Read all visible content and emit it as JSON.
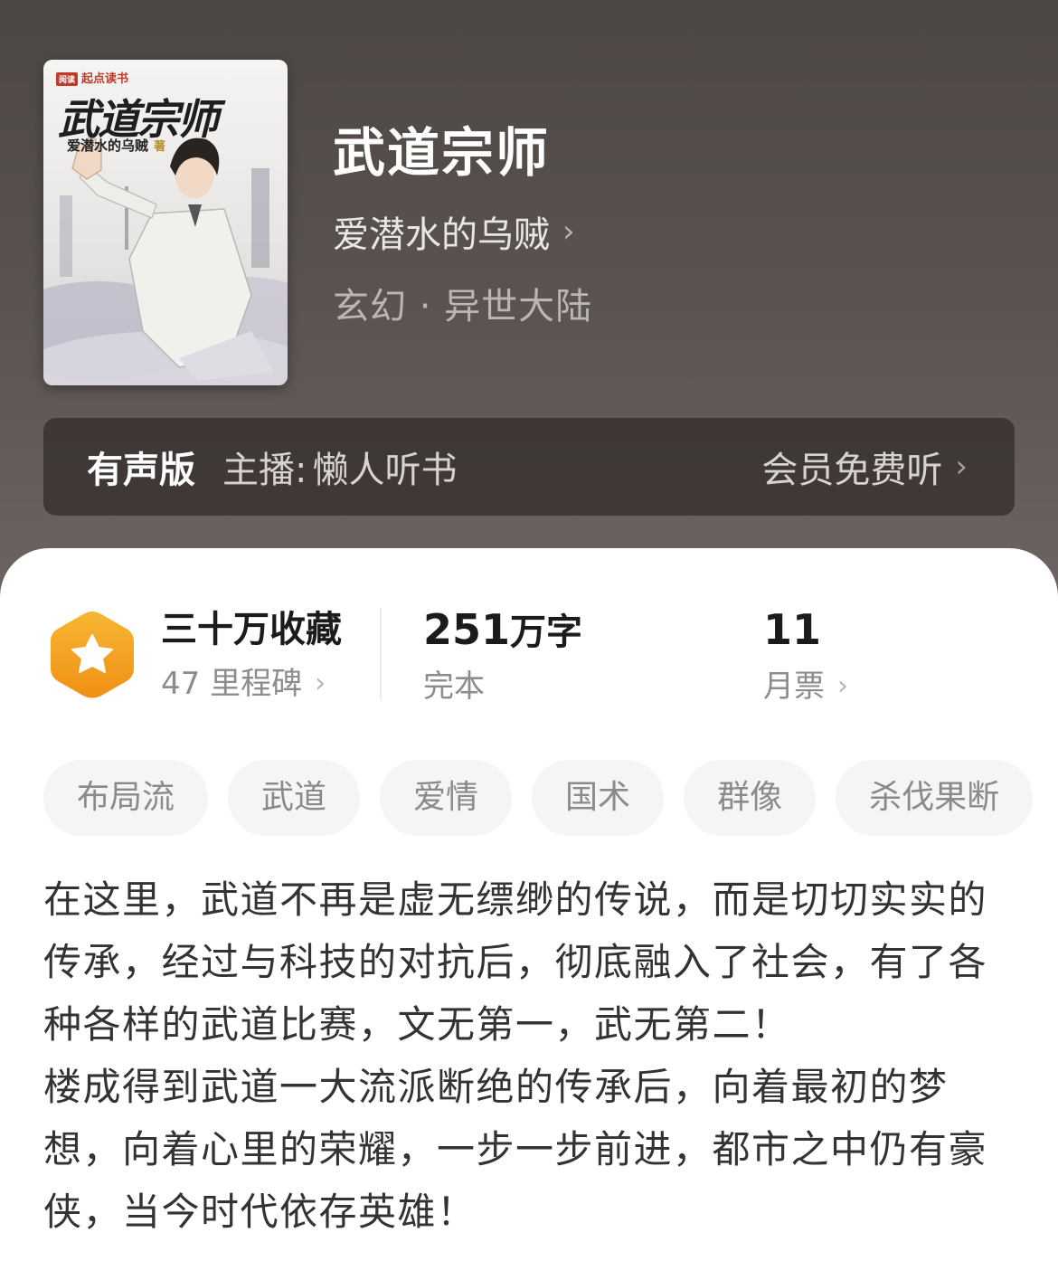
{
  "book": {
    "title": "武道宗师",
    "author": "爱潜水的乌贼",
    "genre": "玄幻 · 异世大陆",
    "cover": {
      "brand": "起点读书",
      "brand_badge": "阅读",
      "title": "武道宗师",
      "author": "爱潜水的乌贼",
      "author_mark": "著"
    }
  },
  "audio": {
    "label": "有声版",
    "host_label": "主播:",
    "host": "懒人听书",
    "cta": "会员免费听"
  },
  "stats": {
    "collections": "三十万收藏",
    "milestones": "47 里程碑",
    "word_count_num": "251",
    "word_count_unit": "万字",
    "status": "完本",
    "monthly_votes": "11",
    "monthly_votes_label": "月票"
  },
  "tags": [
    "布局流",
    "武道",
    "爱情",
    "国术",
    "群像",
    "杀伐果断"
  ],
  "description": [
    "在这里，武道不再是虚无缥缈的传说，而是切切实实的传承，经过与科技的对抗后，彻底融入了社会，有了各种各样的武道比赛，文无第一，武无第二！",
    "楼成得到武道一大流派断绝的传承后，向着最初的梦想，向着心里的荣耀，一步一步前进，都市之中仍有豪侠，当今时代依存英雄！"
  ],
  "icons": {
    "author_chevron": "chevron-right-icon",
    "badge": "star-hexagon-icon"
  },
  "colors": {
    "header_bg": "#5a5350",
    "badge_orange": "#f3a51e",
    "tag_bg": "#f5f5f5"
  }
}
